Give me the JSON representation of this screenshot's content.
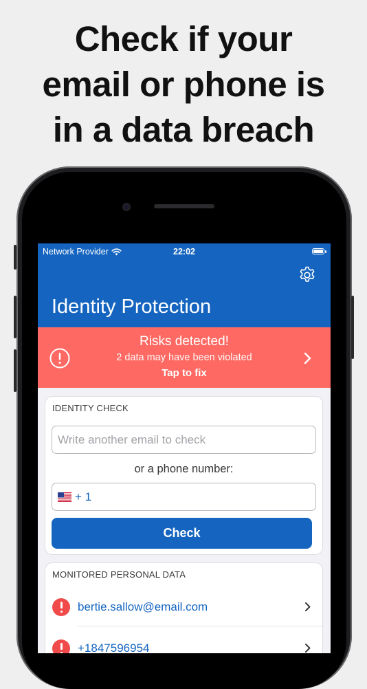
{
  "headline": {
    "line1": "Check if your",
    "line2": "email or phone is",
    "line3": "in a data breach"
  },
  "statusbar": {
    "provider": "Network Provider",
    "time": "22:02"
  },
  "navbar": {
    "title": "Identity Protection",
    "settings_icon": "gear-icon"
  },
  "alert": {
    "title": "Risks detected!",
    "subtitle": "2 data may have been violated",
    "action": "Tap to fix",
    "icon": "exclamation-circle-icon",
    "color": "#fe6a63"
  },
  "identity_check": {
    "section_title": "IDENTITY CHECK",
    "email_placeholder": "Write another email to check",
    "or_label": "or a phone number:",
    "phone_prefix": "+ 1",
    "phone_flag": "us-flag-icon",
    "check_button": "Check"
  },
  "monitored": {
    "section_title": "MONITORED PERSONAL DATA",
    "items": [
      {
        "value": "bertie.sallow@email.com",
        "status_icon": "alert-icon"
      },
      {
        "value": "+1847596954",
        "status_icon": "alert-icon"
      }
    ]
  },
  "colors": {
    "brand": "#1565c0",
    "alert": "#fe6a63",
    "danger": "#f04a4a",
    "background": "#f2f2f6"
  }
}
